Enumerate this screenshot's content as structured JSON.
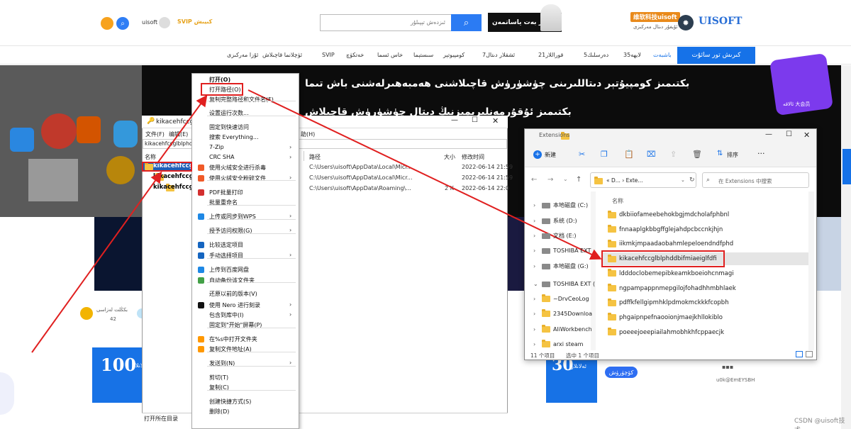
{
  "header": {
    "brand_cn": "维软科技uisoft",
    "brand_ug": "ئۇيغۇر دىتال مەركىزى",
    "brand_logo": "UISOFT",
    "search_placeholder": "ئىزدەش تېپىلۇر",
    "ad_text": "تور بەت ياساتمەن",
    "uisoft_label": "uisoft",
    "svip_label": "SVIP كىيىش"
  },
  "nav": {
    "items": [
      "باشبەت",
      "لايھە35",
      "دەرسلىك5",
      "قوراللار21",
      "ئشقلار دىتال7",
      "كومپيوتېر",
      "سىستېما",
      "خاس ئسما",
      "خەتكۈچ",
      "SVIP",
      "ئۈچلانما قاچىلاش",
      "ئۇزا مەركىزى"
    ],
    "login": "كىرىش تور سائۇت"
  },
  "banner": {
    "line1": "بكتىمىز كومپيۇتېر دىتاللىرىنى چۈشۈرۈش قاچىلاشنى ھەمبەھىرلەشنى باش تىما",
    "line2": "بكتىمىز ئۇقۇرمەنلىرىمىزنىڭ دىتال چۈشۈرۈش قاچىلاش",
    "badge": "ئالاقە 大会员"
  },
  "old_window": {
    "title": "kikacehfccglb",
    "menu": [
      "文件(F)",
      "编辑(E)"
    ],
    "menu_help": "助(H)",
    "address": "kikacehfccglblphddbf",
    "col_name": "名称",
    "col_path": "路径",
    "col_size": "大小",
    "col_date": "修改时间",
    "rows": [
      {
        "name": "kikacehfccglb",
        "path": "C:\\Users\\uisoft\\AppData\\Local\\Micr...",
        "size": "",
        "date": "2022-06-14 21:59"
      },
      {
        "name": "kikacehfccglb",
        "path": "C:\\Users\\uisoft\\AppData\\Local\\Micr...",
        "size": "",
        "date": "2022-06-14 21:59"
      },
      {
        "name": "kikacehfccglb",
        "path": "C:\\Users\\uisoft\\AppData\\Roaming\\...",
        "size": "2 K",
        "date": "2022-06-14 22:0"
      }
    ],
    "status": "打开所在目录"
  },
  "context_menu": {
    "items": [
      {
        "label": "打开(O)",
        "bold": true
      },
      {
        "label": "打开路径(O)"
      },
      {
        "label": "复制完整路径和文件名(F)"
      },
      {
        "label": "设置运行次数..."
      },
      {
        "label": "固定到快速访问"
      },
      {
        "label": "搜索 Everything..."
      },
      {
        "label": "7-Zip",
        "sub": true
      },
      {
        "label": "CRC SHA",
        "sub": true
      },
      {
        "label": "使用火绒安全进行杀毒"
      },
      {
        "label": "使用火绒安全粉碎文件",
        "sub": true
      },
      {
        "label": "PDF批量打印"
      },
      {
        "label": "批量重命名"
      },
      {
        "label": "上传或同步到WPS",
        "sub": true
      },
      {
        "label": "授予访问权限(G)",
        "sub": true
      },
      {
        "label": "比较选定项目"
      },
      {
        "label": "手动选择项目",
        "sub": true
      },
      {
        "label": "上传到百度网盘"
      },
      {
        "label": "自动备份该文件夹"
      },
      {
        "label": "还原以前的版本(V)"
      },
      {
        "label": "使用 Nero 进行刻录",
        "sub": true
      },
      {
        "label": "包含到库中(I)",
        "sub": true
      },
      {
        "label": "固定到\"开始\"屏幕(P)"
      },
      {
        "label": "在%s中打开文件夹"
      },
      {
        "label": "复制文件地址(A)"
      },
      {
        "label": "发送到(N)",
        "sub": true
      },
      {
        "label": "剪切(T)"
      },
      {
        "label": "复制(C)"
      },
      {
        "label": "创建快捷方式(S)"
      },
      {
        "label": "删除(D)"
      }
    ]
  },
  "explorer11": {
    "title": "Extensions",
    "new_label": "新建",
    "sort_label": "排序",
    "breadcrumb": "« D...  ›  Exte...",
    "search_placeholder": "在 Extensions 中搜索",
    "col_name": "名称",
    "sidebar": [
      {
        "label": "本地磁盘 (C:)",
        "type": "drive"
      },
      {
        "label": "系统 (D:)",
        "type": "drive"
      },
      {
        "label": "文档 (E:)",
        "type": "drive"
      },
      {
        "label": "TOSHIBA EXT",
        "type": "drive"
      },
      {
        "label": "本地磁盘 (G:)",
        "type": "drive"
      },
      {
        "label": "TOSHIBA EXT (",
        "type": "drive"
      },
      {
        "label": "~DrvCeoLog",
        "type": "folder"
      },
      {
        "label": "2345Downloa",
        "type": "folder"
      },
      {
        "label": "AliWorkbench",
        "type": "folder"
      },
      {
        "label": "arxi steam",
        "type": "folder"
      }
    ],
    "folders": [
      "dkbiiofameebehokbgjmdcholafphbnl",
      "fnnaaplgkbbgffglejahdpcbccnkjhjn",
      "iikmkjmpaadaobahmlepeloendndfphd",
      "kikacehfccglblphddbifmiaeiglfdfi",
      "ldddoclobemepibkeamkboeiohcnmagi",
      "ngpampappnmepgilojfohadhhmbhlaek",
      "pdffkfellgipmhklpdmokmckkkfcopbh",
      "phgaipnpefnaooionjmaejkhllokiblo",
      "poeeejoeepiailahmobhkhfcppaecjk"
    ],
    "status_count": "11 个项目",
    "status_selected": "选中 1 个项目"
  },
  "bottom": {
    "card1_num": "100",
    "card1_text": "ئىلانلار",
    "card2_num": "30",
    "card2_text": "ئەلانلار",
    "btn_label": "كۆچۈرۈش",
    "code": "u0k@EmEYSBH",
    "left_label": "بكڭلت لەزاسى",
    "left_num": "42",
    "csdn": "CSDN @uisoft技术"
  }
}
